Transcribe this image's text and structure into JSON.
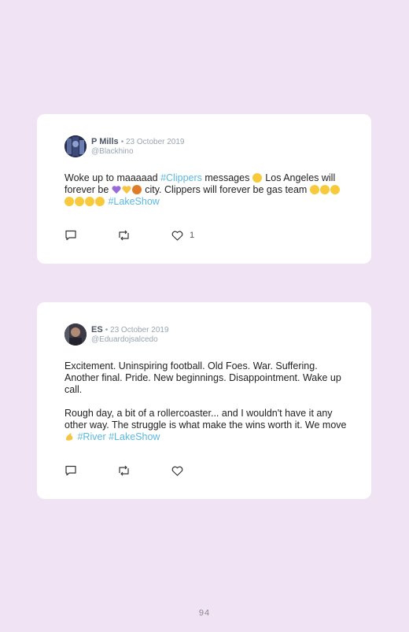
{
  "tweets": [
    {
      "name": "P Mills",
      "date": "• 23 October 2019",
      "handle": "@Blackhino",
      "text": {
        "t1": "Woke up to maaaaad ",
        "tag1": "#Clippers",
        "t2": " messages ",
        "t3": " Los Angeles will forever be ",
        "t4": " city. Clippers will forever be gas team ",
        "tag2": "#LakeShow"
      },
      "likes": "1"
    },
    {
      "name": "ES",
      "date": "• 23 October 2019",
      "handle": "@Eduardojsalcedo",
      "para1": "Excitement. Uninspiring football. Old Foes. War. Suffering. Another final. Pride. New beginnings. Disappointment. Wake up call.",
      "para2": {
        "t1": "Rough day, a bit of a rollercoaster... and I wouldn't have it any other way. The struggle is what make the wins worth it. We move ",
        "tag1": "#River",
        "tag2": "#LakeShow"
      },
      "likes": ""
    }
  ],
  "page_number": "94",
  "icons": {
    "reply": "reply-icon",
    "retweet": "retweet-icon",
    "like": "heart-icon"
  },
  "colors": {
    "background": "#f0e4f4",
    "card": "#ffffff",
    "hashtag": "#5bb8e0"
  }
}
